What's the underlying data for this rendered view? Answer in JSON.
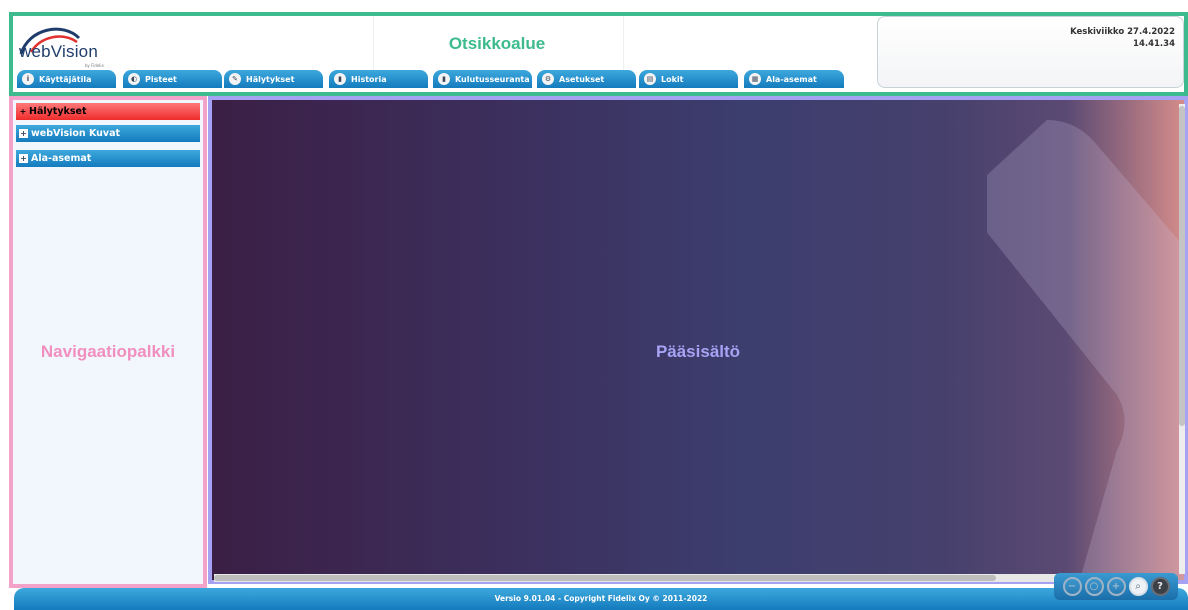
{
  "header": {
    "logo_text": "webVision",
    "logo_sub": "by Fidelix",
    "title": "Otsikkoalue",
    "date": "Keskiviikko 27.4.2022",
    "time": "14.41.34"
  },
  "tabs": [
    {
      "label": "Käyttäjätila",
      "icon": "info-icon"
    },
    {
      "label": "Pisteet",
      "icon": "points-icon"
    },
    {
      "label": "Hälytykset",
      "icon": "alarm-icon"
    },
    {
      "label": "Historia",
      "icon": "chart-icon"
    },
    {
      "label": "Kulutusseuranta",
      "icon": "chart-icon"
    },
    {
      "label": "Asetukset",
      "icon": "settings-icon"
    },
    {
      "label": "Lokit",
      "icon": "log-icon"
    },
    {
      "label": "Ala-asemat",
      "icon": "substation-icon"
    }
  ],
  "nav": {
    "items": [
      {
        "label": "Hälytykset",
        "state": "alarm"
      },
      {
        "label": "webVision Kuvat",
        "state": "collapsed"
      },
      {
        "label": "Ala-asemat",
        "state": "collapsed"
      }
    ],
    "area_label": "Navigaatiopalkki"
  },
  "main": {
    "area_label": "Pääsisältö"
  },
  "footer": {
    "text": "Versio 9.01.04 - Copyright Fidelix Oy © 2011-2022"
  },
  "zoom": {
    "buttons": [
      "zoom-out-icon",
      "zoom-reset-icon",
      "zoom-in-icon",
      "zoom-fit-icon",
      "help-icon"
    ]
  },
  "colors": {
    "header_border": "#3dbb8e",
    "nav_border": "#f3a3c9",
    "main_border": "#a6a2f3",
    "tab_blue": "#1f8fcf",
    "alarm_red": "#ef2b2b"
  }
}
